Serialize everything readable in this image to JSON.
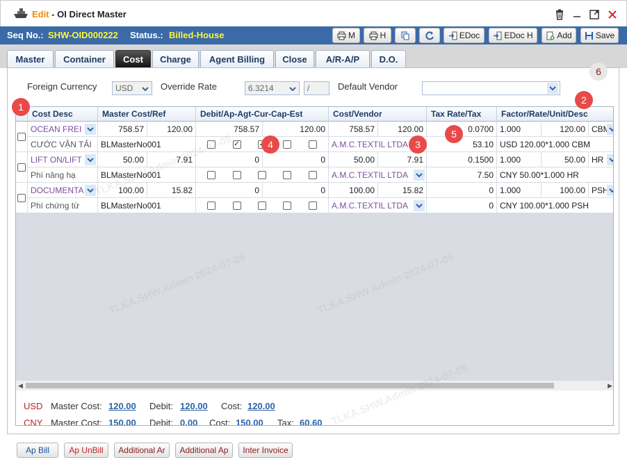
{
  "title": {
    "edit": "Edit",
    "rest": " - OI Direct Master"
  },
  "header": {
    "seq_label": "Seq No.:",
    "seq_value": "SHW-OID000222",
    "status_label": "Status.:",
    "status_value": "Billed-House"
  },
  "toolbar": {
    "print_m": "M",
    "print_h": "H",
    "edoc": "EDoc",
    "edoc_h": "EDoc H",
    "add": "Add",
    "save": "Save"
  },
  "tabs": [
    "Master",
    "Container",
    "Cost",
    "Charge",
    "Agent Billing",
    "Close",
    "A/R-A/P",
    "D.O."
  ],
  "active_tab": "Cost",
  "filters": {
    "foreign_currency_label": "Foreign Currency",
    "foreign_currency_value": "USD",
    "override_rate_label": "Override Rate",
    "override_rate_value": "6.3214",
    "override_rate_extra": "/",
    "default_vendor_label": "Default Vendor",
    "default_vendor_value": ""
  },
  "grid": {
    "headers": [
      "Cost Desc",
      "Master Cost/Ref",
      "Debit/Ap-Agt-Cur-Cap-Est",
      "Cost/Vendor",
      "Tax Rate/Tax",
      "Factor/Rate/Unit/Desc"
    ],
    "rows": [
      {
        "code": "OCEAN FREI",
        "desc": "CƯỚC VẬN TẢI",
        "master_cost": "758.57",
        "master_qty": "120.00",
        "ref": "BLMasterNo001",
        "debit": "758.57",
        "debit2": "120.00",
        "checks": [
          false,
          true,
          true,
          false,
          false
        ],
        "cost": "758.57",
        "cost2": "120.00",
        "vendor": "A.M.C.TEXTIL LTDA",
        "tax_rate": "0.0700",
        "tax": "53.10",
        "factor": "1.000",
        "rate": "120.00",
        "unit": "CBM",
        "unit_desc": "USD 120.00*1.000 CBM"
      },
      {
        "code": "LIFT ON/LIFT",
        "desc": "Phí nâng hạ",
        "master_cost": "50.00",
        "master_qty": "7.91",
        "ref": "BLMasterNo001",
        "debit": "0",
        "debit2": "0",
        "checks": [
          false,
          false,
          false,
          false,
          false
        ],
        "cost": "50.00",
        "cost2": "7.91",
        "vendor": "A.M.C.TEXTIL LTDA",
        "tax_rate": "0.1500",
        "tax": "7.50",
        "factor": "1.000",
        "rate": "50.00",
        "unit": "HR",
        "unit_desc": "CNY 50.00*1.000 HR"
      },
      {
        "code": "DOCUMENTA",
        "desc": "Phí chứng từ",
        "master_cost": "100.00",
        "master_qty": "15.82",
        "ref": "BLMasterNo001",
        "debit": "0",
        "debit2": "0",
        "checks": [
          false,
          false,
          false,
          false,
          false
        ],
        "cost": "100.00",
        "cost2": "15.82",
        "vendor": "A.M.C.TEXTIL LTDA",
        "tax_rate": "0",
        "tax": "0",
        "factor": "1.000",
        "rate": "100.00",
        "unit": "PSH",
        "unit_desc": "CNY 100.00*1.000 PSH"
      }
    ]
  },
  "totals": {
    "usd": {
      "cur": "USD",
      "master_label": "Master Cost:",
      "master": "120.00",
      "debit_label": "Debit:",
      "debit": "120.00",
      "cost_label": "Cost:",
      "cost": "120.00"
    },
    "cny": {
      "cur": "CNY",
      "master_label": "Master Cost:",
      "master": "150.00",
      "debit_label": "Debit:",
      "debit": "0.00",
      "cost_label": "Cost:",
      "cost": "150.00",
      "tax_label": "Tax:",
      "tax": "60.60"
    }
  },
  "bottom_buttons": [
    {
      "label": "Ap Bill",
      "color": "#1a4fa0"
    },
    {
      "label": "Ap UnBill",
      "color": "#c0232a"
    },
    {
      "label": "Additional Ar",
      "color": "#8b1b1b"
    },
    {
      "label": "Additional Ap",
      "color": "#8b1b1b"
    },
    {
      "label": "Inter Invoice",
      "color": "#8b1b1b"
    }
  ],
  "markers": [
    "1",
    "2",
    "3",
    "4",
    "5",
    "6"
  ],
  "watermark": "TLKA.SHW.Admin 2024-07-05",
  "colors": {
    "header_bar": "#3a6aa8",
    "accent_yellow": "#fdf53a",
    "edit_orange": "#f08c00",
    "link_blue": "#2d63a8",
    "currency_red": "#b8242b"
  }
}
